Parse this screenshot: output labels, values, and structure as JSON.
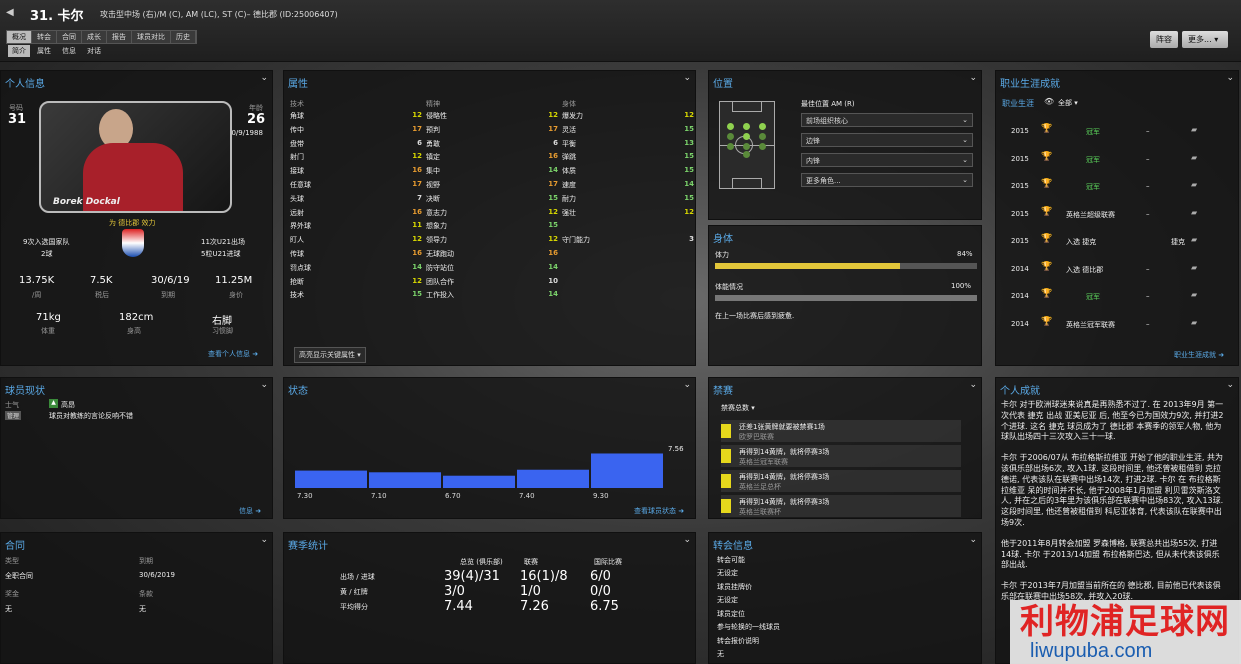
{
  "header": {
    "title": "31. 卡尔",
    "subtitle": "攻击型中场 (右)/M (C), AM (LC), ST (C)– 德比郡 (ID:25006407)",
    "tabs": [
      "概况",
      "转会",
      "合同",
      "成长",
      "报告",
      "球员对比",
      "历史"
    ],
    "subtabs": [
      "简介",
      "属性",
      "信息",
      "对话"
    ],
    "btn_squad": "阵容",
    "btn_more": "更多..."
  },
  "personal": {
    "title": "个人信息",
    "number_label": "号码",
    "number": "31",
    "age_label": "年龄",
    "age": "26",
    "dob": "30/9/1988",
    "photo_name": "Borek Dockal",
    "plays_for": "为 德比郡 效力",
    "caps": "9次入选国家队",
    "goals": "2球",
    "u21_caps": "11次U21出场",
    "u21_goals": "5粒U21进球",
    "wage": "13.75K",
    "wage_label": "/周",
    "pretax": "7.5K",
    "pretax_label": "税后",
    "expiry": "30/6/19",
    "expiry_label": "到期",
    "value": "11.25M",
    "value_label": "身价",
    "weight": "71kg",
    "weight_label": "体重",
    "height": "182cm",
    "height_label": "身高",
    "foot": "右脚",
    "foot_label": "习惯脚",
    "link": "查看个人信息"
  },
  "attributes": {
    "title": "属性",
    "headers": [
      "技术",
      "精神",
      "身体"
    ],
    "technical": [
      [
        "角球",
        "12",
        "c-yel"
      ],
      [
        "传中",
        "17",
        "c-org"
      ],
      [
        "盘带",
        "6",
        "c-wht"
      ],
      [
        "射门",
        "12",
        "c-yel"
      ],
      [
        "接球",
        "16",
        "c-org"
      ],
      [
        "任意球",
        "17",
        "c-org"
      ],
      [
        "头球",
        "7",
        "c-wht"
      ],
      [
        "远射",
        "16",
        "c-org"
      ],
      [
        "界外球",
        "11",
        "c-yel"
      ],
      [
        "盯人",
        "12",
        "c-yel"
      ],
      [
        "传球",
        "16",
        "c-org"
      ],
      [
        "罚点球",
        "14",
        "c-grn"
      ],
      [
        "抢断",
        "12",
        "c-yel"
      ],
      [
        "技术",
        "15",
        "c-grn"
      ]
    ],
    "mental": [
      [
        "侵略性",
        "12",
        "c-yel"
      ],
      [
        "预判",
        "17",
        "c-org"
      ],
      [
        "勇敢",
        "6",
        "c-wht"
      ],
      [
        "镇定",
        "16",
        "c-org"
      ],
      [
        "集中",
        "14",
        "c-grn"
      ],
      [
        "视野",
        "17",
        "c-org"
      ],
      [
        "决断",
        "15",
        "c-grn"
      ],
      [
        "意志力",
        "12",
        "c-yel"
      ],
      [
        "想象力",
        "15",
        "c-grn"
      ],
      [
        "领导力",
        "12",
        "c-yel"
      ],
      [
        "无球跑动",
        "16",
        "c-org"
      ],
      [
        "防守站位",
        "14",
        "c-grn"
      ],
      [
        "团队合作",
        "10",
        "c-wht"
      ],
      [
        "工作投入",
        "14",
        "c-grn"
      ]
    ],
    "physical": [
      [
        "爆发力",
        "12",
        "c-yel"
      ],
      [
        "灵活",
        "15",
        "c-grn"
      ],
      [
        "平衡",
        "13",
        "c-grn"
      ],
      [
        "弹跳",
        "15",
        "c-grn"
      ],
      [
        "体质",
        "15",
        "c-grn"
      ],
      [
        "速度",
        "14",
        "c-grn"
      ],
      [
        "耐力",
        "15",
        "c-grn"
      ],
      [
        "强壮",
        "12",
        "c-yel"
      ],
      [
        "",
        "",
        ""
      ],
      [
        "守门能力",
        "3",
        "c-wht"
      ]
    ],
    "highlight": "高亮显示关键属性"
  },
  "position": {
    "title": "位置",
    "best_label": "最佳位置 AM (R)",
    "roles": [
      "前场组织核心",
      "边锋",
      "内锋",
      "更多角色..."
    ]
  },
  "physical": {
    "title": "身体",
    "stamina_label": "体力",
    "stamina": "84%",
    "stamina_pct": 84,
    "condition_label": "体能情况",
    "condition": "100%",
    "condition_pct": 100,
    "note": "在上一场比赛后感到疲惫."
  },
  "career": {
    "title": "职业生涯成就",
    "filter_label": "职业生涯",
    "filter": "全部",
    "rows": [
      [
        "2015",
        "冠军",
        "–"
      ],
      [
        "2015",
        "冠军",
        "–"
      ],
      [
        "2015",
        "冠军",
        "–"
      ],
      [
        "2015",
        "英格兰超级联赛",
        "–"
      ],
      [
        "2015",
        "入选 捷克",
        "捷克"
      ],
      [
        "2014",
        "入选 德比郡",
        "–"
      ],
      [
        "2014",
        "冠军",
        "–"
      ],
      [
        "2014",
        "英格兰冠军联赛",
        "–"
      ]
    ],
    "link": "职业生涯成就"
  },
  "status": {
    "title": "球员现状",
    "morale_label": "士气",
    "morale": "高昂",
    "tag": "管理",
    "note": "球员对教练的言论反响不错",
    "link": "信息"
  },
  "form": {
    "title": "状态",
    "avg": "7.56",
    "link": "查看球员状态"
  },
  "bans": {
    "title": "禁赛",
    "dropdown": "禁赛总数",
    "rows": [
      [
        "还差1张黄牌就要被禁赛1场",
        "欧罗巴联赛"
      ],
      [
        "再得到14黄牌，就将停赛3场",
        "英格兰冠军联赛"
      ],
      [
        "再得到14黄牌，就将停赛3场",
        "英格兰足总杯"
      ],
      [
        "再得到14黄牌，就将停赛3场",
        "英格兰联赛杯"
      ]
    ]
  },
  "bio": {
    "title": "个人成就",
    "paragraphs": [
      "卡尔 对于欧洲球迷来说真是再熟悉不过了. 在 2013年9月 第一次代表 捷克 出战 亚美尼亚 后, 他至今已为国效力9次, 并打进2个进球. 这名 捷克 球员成为了 德比郡 本赛季的领军人物, 他为球队出场四十三次攻入三十一球.",
      "卡尔 于2006/07从 布拉格斯拉维亚 开始了他的职业生涯, 共为该俱乐部出场6次, 攻入1球. 这段时间里, 他还曾被租借到 克拉德诺, 代表该队在联赛中出场14次, 打进2球. 卡尔 在 布拉格斯拉维亚 呆的时间并不长, 他于2008年1月加盟 利贝雷茨斯洛文人, 并在之后的3年里为该俱乐部在联赛中出场83次, 攻入13球. 这段时间里, 他还曾被租借到 科尼亚体育, 代表该队在联赛中出场9次.",
      "他于2011年8月转会加盟 罗森博格, 联赛总共出场55次, 打进14球. 卡尔 于2013/14加盟 布拉格斯巴达, 但从未代表该俱乐部出战.",
      "卡尔 于2013年7月加盟当前所在的 德比郡, 目前他已代表该俱乐部在联赛中出场58次, 并攻入20球."
    ]
  },
  "contract": {
    "title": "合同",
    "type_label": "类型",
    "type": "全职合同",
    "expiry_label": "到期",
    "expiry": "30/6/2019",
    "bonus_label": "奖金",
    "bonus": "无",
    "clause_label": "条款",
    "clause": "无"
  },
  "season": {
    "title": "赛季统计",
    "cols": [
      "总览 (俱乐部)",
      "联赛",
      "国际比赛"
    ],
    "rows": [
      [
        "出场 / 进球",
        "39(4)/31",
        "16(1)/8",
        "6/0"
      ],
      [
        "黄 / 红牌",
        "3/0",
        "1/0",
        "0/0"
      ],
      [
        "平均得分",
        "7.44",
        "7.26",
        "6.75"
      ]
    ]
  },
  "transfer": {
    "title": "转会信息",
    "items": [
      [
        "转会可能",
        "无设定"
      ],
      [
        "球员挂牌价",
        "无设定"
      ],
      [
        "球员定位",
        "参与轮换的一线球员"
      ],
      [
        "转会报价说明",
        "无"
      ]
    ]
  },
  "watermark": {
    "line1": "利物浦足球网",
    "line2": "liwupuba.com"
  },
  "chart_data": {
    "type": "bar",
    "categories": [
      "1",
      "2",
      "3",
      "4",
      "5"
    ],
    "values": [
      7.3,
      7.1,
      6.7,
      7.4,
      9.3
    ],
    "title": "状态",
    "xlabel": "",
    "ylabel": "",
    "ylim": [
      0,
      10
    ]
  }
}
